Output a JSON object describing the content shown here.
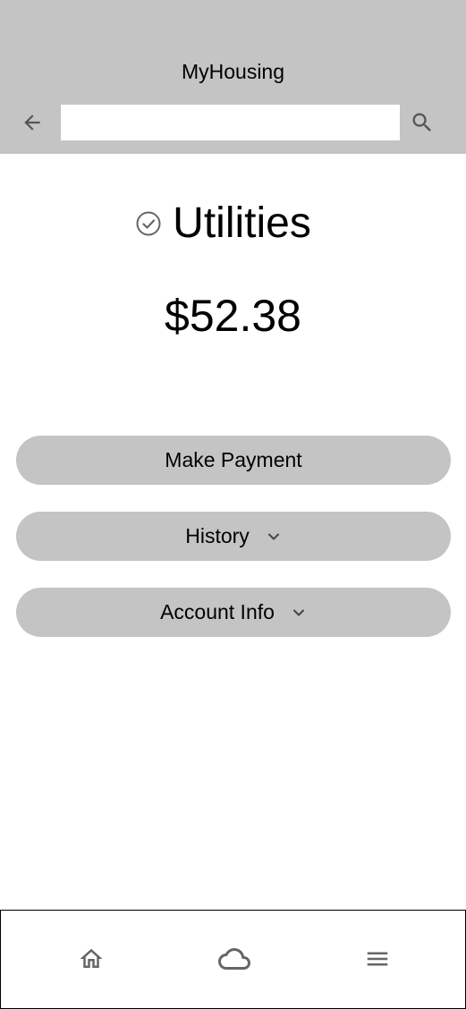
{
  "app": {
    "title": "MyHousing"
  },
  "search": {
    "value": "",
    "placeholder": ""
  },
  "icons": {
    "back": "arrow-left-icon",
    "search": "search-icon",
    "title": "check-circle-icon",
    "history_expand": "chevron-down-icon",
    "account_expand": "chevron-down-icon",
    "nav_home": "home-icon",
    "nav_cloud": "cloud-icon",
    "nav_menu": "menu-icon"
  },
  "colors": {
    "header_bg": "#c4c4c4",
    "button_bg": "#c4c4c4",
    "icon": "#666666"
  },
  "main": {
    "title": "Utilities",
    "amount": "$52.38"
  },
  "actions": {
    "make_payment": "Make Payment",
    "history": "History",
    "account_info": "Account Info"
  }
}
